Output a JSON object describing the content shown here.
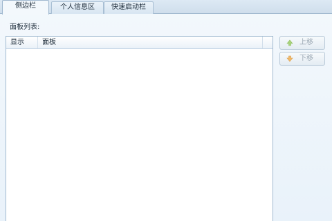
{
  "tabs": [
    {
      "label": "侧边栏",
      "active": true
    },
    {
      "label": "个人信息区",
      "active": false
    },
    {
      "label": "快速启动栏",
      "active": false
    }
  ],
  "panel_list_label": "面板列表:",
  "list": {
    "columns": [
      "显示",
      "面板"
    ],
    "rows": []
  },
  "buttons": {
    "move_up": {
      "label": "上移",
      "enabled": false,
      "icon": "arrow-up-icon"
    },
    "move_down": {
      "label": "下移",
      "enabled": false,
      "icon": "arrow-down-icon"
    }
  },
  "colors": {
    "up_arrow": "#a8d27a",
    "down_arrow": "#f0b96a"
  }
}
